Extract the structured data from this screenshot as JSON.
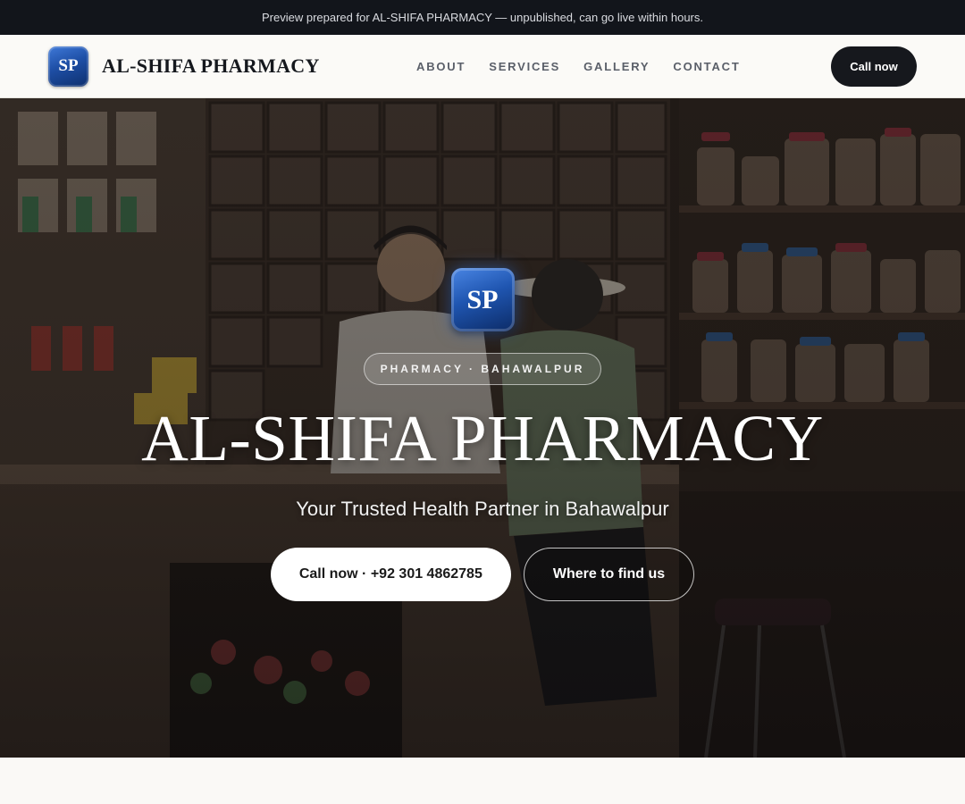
{
  "banner": {
    "text": "Preview prepared for AL-SHIFA PHARMACY — unpublished, can go live within hours."
  },
  "header": {
    "logo_initials": "SP",
    "brand_name": "AL-SHIFA PHARMACY",
    "nav": [
      {
        "label": "ABOUT"
      },
      {
        "label": "SERVICES"
      },
      {
        "label": "GALLERY"
      },
      {
        "label": "CONTACT"
      }
    ],
    "cta_label": "Call now"
  },
  "hero": {
    "logo_initials": "SP",
    "tagline": "PHARMACY · BAHAWALPUR",
    "title": "AL-SHIFA PHARMACY",
    "subtitle": "Your Trusted Health Partner in Bahawalpur",
    "primary_button": "Call now · +92 301 4862785",
    "secondary_button": "Where to find us",
    "background_image": "pharmacy-counter-photo"
  },
  "colors": {
    "dark": "#16181d",
    "accent_blue": "#1f55b0",
    "white": "#ffffff"
  }
}
